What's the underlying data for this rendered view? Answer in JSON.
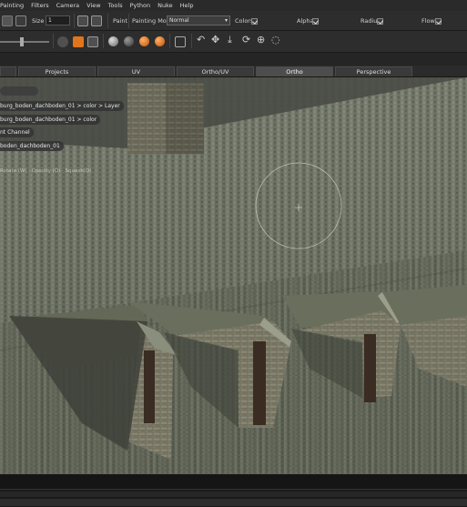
{
  "menu": [
    "Painting",
    "Filters",
    "Camera",
    "View",
    "Tools",
    "Python",
    "Nuke",
    "Help"
  ],
  "toolbar1": {
    "size_label": "Size",
    "size_value": "1",
    "paint_label": "Paint",
    "painting_mode_label": "Painting Mode",
    "painting_mode_value": "Normal",
    "colors_label": "Colors",
    "alpha_label": "Alpha",
    "radius_label": "Radius",
    "flow_label": "Flow"
  },
  "tabs": [
    "Projects",
    "UV",
    "Ortho/UV",
    "Ortho",
    "Perspective"
  ],
  "active_tab": "Ortho",
  "viewport": {
    "layers": [
      "burg_boden_dachboden_01 > color > Layer",
      "burg_boden_dachboden_01 > color",
      "nt Channel",
      "boden_dachboden_01"
    ],
    "hint": "Rotate (W) · Opacity (O) · Squash(Q)"
  },
  "colors": {
    "menubar_bg": "#2a2a2a",
    "toolbar_bg": "#2d2d2d",
    "active_tab": "#4d4d4d",
    "accent_orange": "#e0761c"
  },
  "icons": [
    "paint-brush-icon",
    "undo-icon",
    "move-icon",
    "rotate-icon",
    "scale-icon",
    "lasso-icon"
  ]
}
